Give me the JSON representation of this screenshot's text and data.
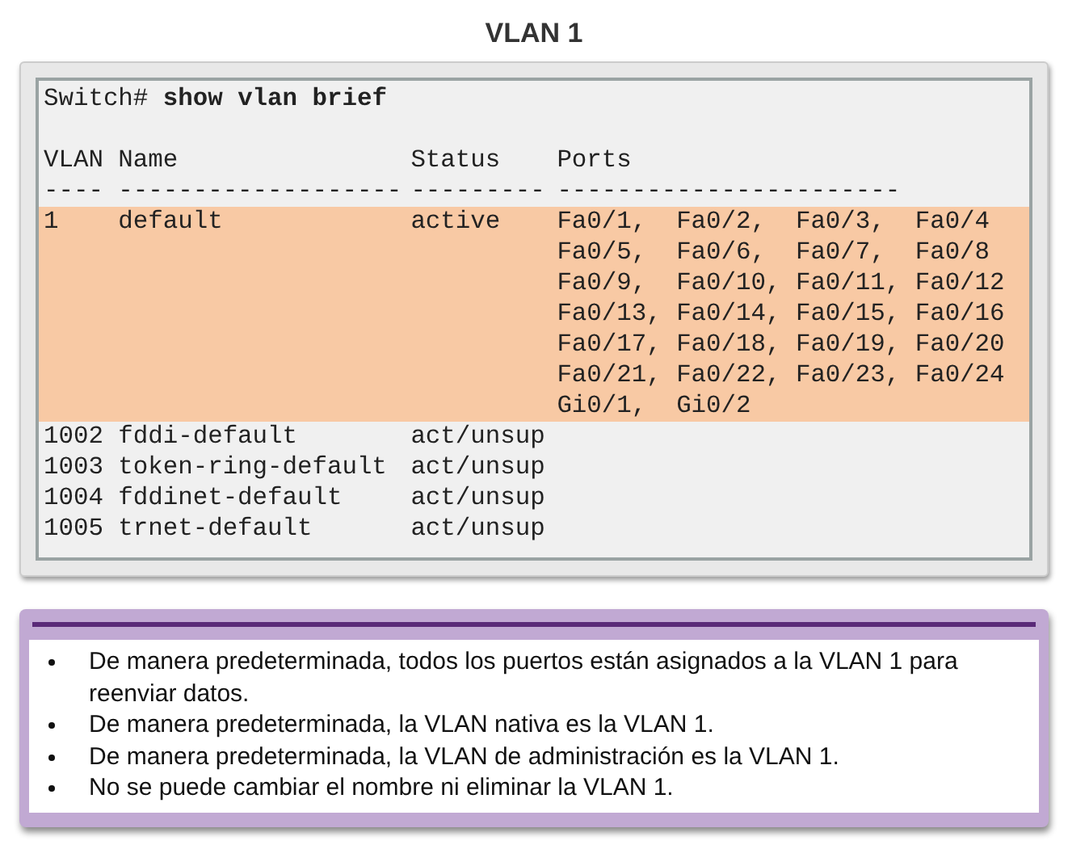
{
  "title": "VLAN 1",
  "terminal": {
    "prompt": "Switch#",
    "command": "show vlan brief",
    "columns": [
      {
        "label": "VLAN",
        "rule": "----"
      },
      {
        "label": "Name",
        "rule": "-------------------"
      },
      {
        "label": "Status",
        "rule": "---------"
      },
      {
        "label": "Ports",
        "rule": "-----------------------"
      }
    ],
    "rows": [
      {
        "vlan": "1",
        "name": "default",
        "status": "active",
        "highlighted": true,
        "ports": [
          "Fa0/1,  Fa0/2,  Fa0/3,  Fa0/4",
          "Fa0/5,  Fa0/6,  Fa0/7,  Fa0/8",
          "Fa0/9,  Fa0/10, Fa0/11, Fa0/12",
          "Fa0/13, Fa0/14, Fa0/15, Fa0/16",
          "Fa0/17, Fa0/18, Fa0/19, Fa0/20",
          "Fa0/21, Fa0/22, Fa0/23, Fa0/24",
          "Gi0/1,  Gi0/2"
        ]
      },
      {
        "vlan": "1002",
        "name": "fddi-default",
        "status": "act/unsup",
        "highlighted": false,
        "ports": []
      },
      {
        "vlan": "1003",
        "name": "token-ring-default",
        "status": "act/unsup",
        "highlighted": false,
        "ports": []
      },
      {
        "vlan": "1004",
        "name": "fddinet-default",
        "status": "act/unsup",
        "highlighted": false,
        "ports": []
      },
      {
        "vlan": "1005",
        "name": "trnet-default",
        "status": "act/unsup",
        "highlighted": false,
        "ports": []
      }
    ]
  },
  "notes": [
    "De manera predeterminada, todos los puertos están asignados a la VLAN 1 para reenviar datos.",
    "De manera predeterminada, la VLAN nativa es la VLAN 1.",
    "De manera predeterminada, la VLAN de administración es la VLAN 1.",
    "No se puede cambiar el nombre ni eliminar la VLAN 1."
  ]
}
